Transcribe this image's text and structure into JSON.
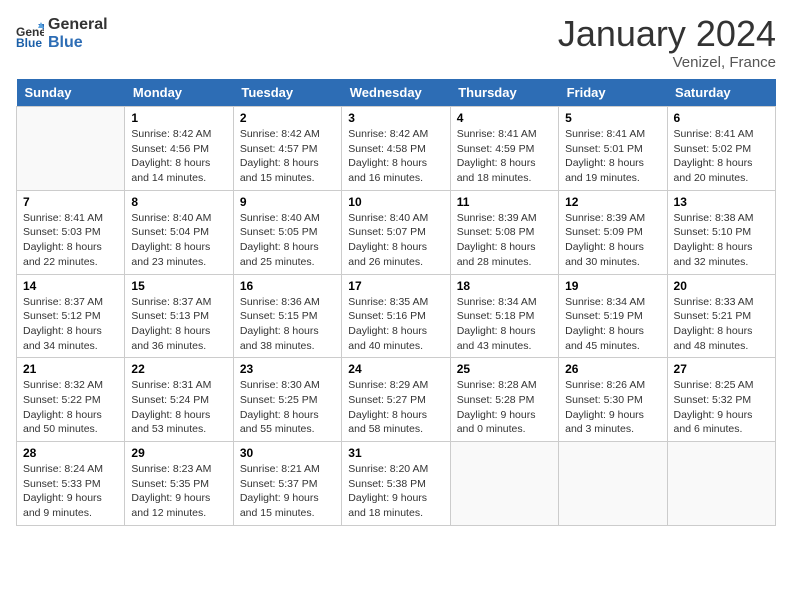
{
  "logo": {
    "line1": "General",
    "line2": "Blue"
  },
  "title": "January 2024",
  "location": "Venizel, France",
  "headers": [
    "Sunday",
    "Monday",
    "Tuesday",
    "Wednesday",
    "Thursday",
    "Friday",
    "Saturday"
  ],
  "weeks": [
    [
      {
        "day": "",
        "sunrise": "",
        "sunset": "",
        "daylight": ""
      },
      {
        "day": "1",
        "sunrise": "Sunrise: 8:42 AM",
        "sunset": "Sunset: 4:56 PM",
        "daylight": "Daylight: 8 hours and 14 minutes."
      },
      {
        "day": "2",
        "sunrise": "Sunrise: 8:42 AM",
        "sunset": "Sunset: 4:57 PM",
        "daylight": "Daylight: 8 hours and 15 minutes."
      },
      {
        "day": "3",
        "sunrise": "Sunrise: 8:42 AM",
        "sunset": "Sunset: 4:58 PM",
        "daylight": "Daylight: 8 hours and 16 minutes."
      },
      {
        "day": "4",
        "sunrise": "Sunrise: 8:41 AM",
        "sunset": "Sunset: 4:59 PM",
        "daylight": "Daylight: 8 hours and 18 minutes."
      },
      {
        "day": "5",
        "sunrise": "Sunrise: 8:41 AM",
        "sunset": "Sunset: 5:01 PM",
        "daylight": "Daylight: 8 hours and 19 minutes."
      },
      {
        "day": "6",
        "sunrise": "Sunrise: 8:41 AM",
        "sunset": "Sunset: 5:02 PM",
        "daylight": "Daylight: 8 hours and 20 minutes."
      }
    ],
    [
      {
        "day": "7",
        "sunrise": "Sunrise: 8:41 AM",
        "sunset": "Sunset: 5:03 PM",
        "daylight": "Daylight: 8 hours and 22 minutes."
      },
      {
        "day": "8",
        "sunrise": "Sunrise: 8:40 AM",
        "sunset": "Sunset: 5:04 PM",
        "daylight": "Daylight: 8 hours and 23 minutes."
      },
      {
        "day": "9",
        "sunrise": "Sunrise: 8:40 AM",
        "sunset": "Sunset: 5:05 PM",
        "daylight": "Daylight: 8 hours and 25 minutes."
      },
      {
        "day": "10",
        "sunrise": "Sunrise: 8:40 AM",
        "sunset": "Sunset: 5:07 PM",
        "daylight": "Daylight: 8 hours and 26 minutes."
      },
      {
        "day": "11",
        "sunrise": "Sunrise: 8:39 AM",
        "sunset": "Sunset: 5:08 PM",
        "daylight": "Daylight: 8 hours and 28 minutes."
      },
      {
        "day": "12",
        "sunrise": "Sunrise: 8:39 AM",
        "sunset": "Sunset: 5:09 PM",
        "daylight": "Daylight: 8 hours and 30 minutes."
      },
      {
        "day": "13",
        "sunrise": "Sunrise: 8:38 AM",
        "sunset": "Sunset: 5:10 PM",
        "daylight": "Daylight: 8 hours and 32 minutes."
      }
    ],
    [
      {
        "day": "14",
        "sunrise": "Sunrise: 8:37 AM",
        "sunset": "Sunset: 5:12 PM",
        "daylight": "Daylight: 8 hours and 34 minutes."
      },
      {
        "day": "15",
        "sunrise": "Sunrise: 8:37 AM",
        "sunset": "Sunset: 5:13 PM",
        "daylight": "Daylight: 8 hours and 36 minutes."
      },
      {
        "day": "16",
        "sunrise": "Sunrise: 8:36 AM",
        "sunset": "Sunset: 5:15 PM",
        "daylight": "Daylight: 8 hours and 38 minutes."
      },
      {
        "day": "17",
        "sunrise": "Sunrise: 8:35 AM",
        "sunset": "Sunset: 5:16 PM",
        "daylight": "Daylight: 8 hours and 40 minutes."
      },
      {
        "day": "18",
        "sunrise": "Sunrise: 8:34 AM",
        "sunset": "Sunset: 5:18 PM",
        "daylight": "Daylight: 8 hours and 43 minutes."
      },
      {
        "day": "19",
        "sunrise": "Sunrise: 8:34 AM",
        "sunset": "Sunset: 5:19 PM",
        "daylight": "Daylight: 8 hours and 45 minutes."
      },
      {
        "day": "20",
        "sunrise": "Sunrise: 8:33 AM",
        "sunset": "Sunset: 5:21 PM",
        "daylight": "Daylight: 8 hours and 48 minutes."
      }
    ],
    [
      {
        "day": "21",
        "sunrise": "Sunrise: 8:32 AM",
        "sunset": "Sunset: 5:22 PM",
        "daylight": "Daylight: 8 hours and 50 minutes."
      },
      {
        "day": "22",
        "sunrise": "Sunrise: 8:31 AM",
        "sunset": "Sunset: 5:24 PM",
        "daylight": "Daylight: 8 hours and 53 minutes."
      },
      {
        "day": "23",
        "sunrise": "Sunrise: 8:30 AM",
        "sunset": "Sunset: 5:25 PM",
        "daylight": "Daylight: 8 hours and 55 minutes."
      },
      {
        "day": "24",
        "sunrise": "Sunrise: 8:29 AM",
        "sunset": "Sunset: 5:27 PM",
        "daylight": "Daylight: 8 hours and 58 minutes."
      },
      {
        "day": "25",
        "sunrise": "Sunrise: 8:28 AM",
        "sunset": "Sunset: 5:28 PM",
        "daylight": "Daylight: 9 hours and 0 minutes."
      },
      {
        "day": "26",
        "sunrise": "Sunrise: 8:26 AM",
        "sunset": "Sunset: 5:30 PM",
        "daylight": "Daylight: 9 hours and 3 minutes."
      },
      {
        "day": "27",
        "sunrise": "Sunrise: 8:25 AM",
        "sunset": "Sunset: 5:32 PM",
        "daylight": "Daylight: 9 hours and 6 minutes."
      }
    ],
    [
      {
        "day": "28",
        "sunrise": "Sunrise: 8:24 AM",
        "sunset": "Sunset: 5:33 PM",
        "daylight": "Daylight: 9 hours and 9 minutes."
      },
      {
        "day": "29",
        "sunrise": "Sunrise: 8:23 AM",
        "sunset": "Sunset: 5:35 PM",
        "daylight": "Daylight: 9 hours and 12 minutes."
      },
      {
        "day": "30",
        "sunrise": "Sunrise: 8:21 AM",
        "sunset": "Sunset: 5:37 PM",
        "daylight": "Daylight: 9 hours and 15 minutes."
      },
      {
        "day": "31",
        "sunrise": "Sunrise: 8:20 AM",
        "sunset": "Sunset: 5:38 PM",
        "daylight": "Daylight: 9 hours and 18 minutes."
      },
      {
        "day": "",
        "sunrise": "",
        "sunset": "",
        "daylight": ""
      },
      {
        "day": "",
        "sunrise": "",
        "sunset": "",
        "daylight": ""
      },
      {
        "day": "",
        "sunrise": "",
        "sunset": "",
        "daylight": ""
      }
    ]
  ]
}
